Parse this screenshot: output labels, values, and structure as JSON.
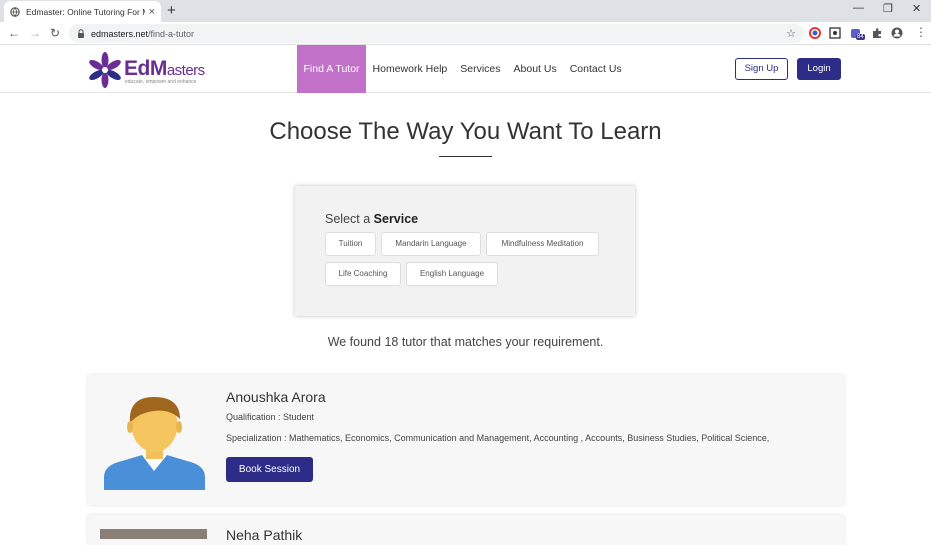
{
  "browser": {
    "tab_title": "Edmaster: Online Tutoring For M",
    "tab_close": "×",
    "new_tab": "+",
    "url_host": "edmasters.net",
    "url_path": "/find-a-tutor",
    "back": "←",
    "forward": "→",
    "reload": "↻",
    "bookmark": "☆",
    "minimize": "—",
    "restore": "❐",
    "close": "✕",
    "menu": "⋮",
    "extension_badge": "84"
  },
  "site": {
    "logo_main": "EdM",
    "logo_rest": "asters",
    "logo_tagline": "educate, empower and enhance",
    "nav": [
      "Find A Tutor",
      "Homework Help",
      "Services",
      "About Us",
      "Contact Us"
    ],
    "active_nav": "Find A Tutor",
    "signup": "Sign Up",
    "login": "Login",
    "accent_color": "#c171c7",
    "brand_color": "#2d2c86"
  },
  "main": {
    "heading": "Choose The Way You Want To Learn",
    "select_prefix": "Select a",
    "select_bold": "Service",
    "services": [
      "Tuition",
      "Mandarin Language",
      "Mindfulness Meditation",
      "Life Coaching",
      "English Language"
    ],
    "found_text": "We found 18 tutor that matches your requirement."
  },
  "tutors": [
    {
      "name": "Anoushka Arora",
      "qualification": "Qualification : Student",
      "specialization": "Specialization : Mathematics, Economics, Communication and Management, Accounting , Accounts, Business Studies, Political Science,",
      "button": "Book Session"
    },
    {
      "name": "Neha Pathik"
    }
  ]
}
